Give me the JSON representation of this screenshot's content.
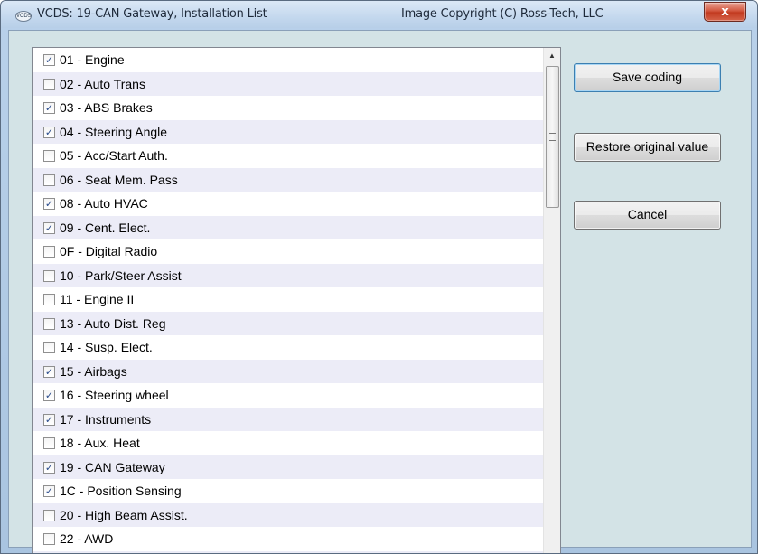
{
  "window": {
    "title": "VCDS: 19-CAN Gateway,  Installation List",
    "copyright": "Image Copyright (C) Ross-Tech, LLC",
    "app_icon": "vcds-app-icon",
    "close_label": "x"
  },
  "buttons": {
    "save": "Save coding",
    "restore": "Restore original value",
    "cancel": "Cancel"
  },
  "check_glyph": "✓",
  "list": {
    "items": [
      {
        "label": "01 - Engine",
        "checked": true
      },
      {
        "label": "02 - Auto Trans",
        "checked": false
      },
      {
        "label": "03 - ABS Brakes",
        "checked": true
      },
      {
        "label": "04 - Steering Angle",
        "checked": true
      },
      {
        "label": "05 - Acc/Start Auth.",
        "checked": false
      },
      {
        "label": "06 - Seat Mem. Pass",
        "checked": false
      },
      {
        "label": "08 - Auto HVAC",
        "checked": true
      },
      {
        "label": "09 - Cent. Elect.",
        "checked": true
      },
      {
        "label": "0F - Digital Radio",
        "checked": false
      },
      {
        "label": "10 - Park/Steer Assist",
        "checked": false
      },
      {
        "label": "11 - Engine II",
        "checked": false
      },
      {
        "label": "13 - Auto Dist. Reg",
        "checked": false
      },
      {
        "label": "14 - Susp. Elect.",
        "checked": false
      },
      {
        "label": "15 - Airbags",
        "checked": true
      },
      {
        "label": "16 - Steering wheel",
        "checked": true
      },
      {
        "label": "17 - Instruments",
        "checked": true
      },
      {
        "label": "18 - Aux. Heat",
        "checked": false
      },
      {
        "label": "19 - CAN Gateway",
        "checked": true
      },
      {
        "label": "1C - Position Sensing",
        "checked": true
      },
      {
        "label": "20 - High Beam Assist.",
        "checked": false
      },
      {
        "label": "22 - AWD",
        "checked": false
      }
    ]
  },
  "scrollbar": {
    "up_icon": "▲",
    "down_icon": "▼"
  }
}
